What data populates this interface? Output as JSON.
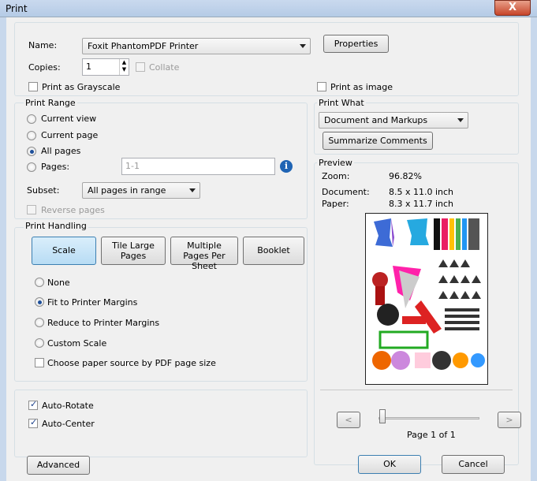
{
  "window": {
    "title": "Print",
    "close_label": "X"
  },
  "printer": {
    "name_label": "Name:",
    "name_value": "Foxit PhantomPDF Printer",
    "properties_label": "Properties",
    "copies_label": "Copies:",
    "copies_value": "1",
    "collate_label": "Collate",
    "grayscale_label": "Print as Grayscale",
    "print_as_image_label": "Print as image"
  },
  "print_range": {
    "title": "Print Range",
    "current_view": "Current view",
    "current_page": "Current page",
    "all_pages": "All pages",
    "pages": "Pages:",
    "pages_value": "1-1",
    "subset_label": "Subset:",
    "subset_value": "All pages in range",
    "reverse_label": "Reverse pages"
  },
  "print_what": {
    "title": "Print What",
    "value": "Document and Markups",
    "summarize_label": "Summarize Comments"
  },
  "preview": {
    "title": "Preview",
    "zoom_label": "Zoom:",
    "zoom_value": "96.82%",
    "document_label": "Document:",
    "document_value": "8.5 x 11.0 inch",
    "paper_label": "Paper:",
    "paper_value": "8.3 x 11.7 inch",
    "page_status": "Page 1 of 1",
    "prev_label": "<",
    "next_label": ">"
  },
  "print_handling": {
    "title": "Print Handling",
    "tabs": [
      "Scale",
      "Tile Large Pages",
      "Multiple Pages Per Sheet",
      "Booklet"
    ],
    "none": "None",
    "fit": "Fit to Printer Margins",
    "reduce": "Reduce to Printer Margins",
    "custom": "Custom Scale",
    "paper_source": "Choose paper source by PDF page size"
  },
  "options": {
    "auto_rotate": "Auto-Rotate",
    "auto_center": "Auto-Center"
  },
  "footer": {
    "advanced_label": "Advanced",
    "ok_label": "OK",
    "cancel_label": "Cancel"
  },
  "colors": {
    "accent": "#1d4f9a",
    "selected_tab": "#c5e3f7",
    "title_bar": "#c8d8ec"
  }
}
